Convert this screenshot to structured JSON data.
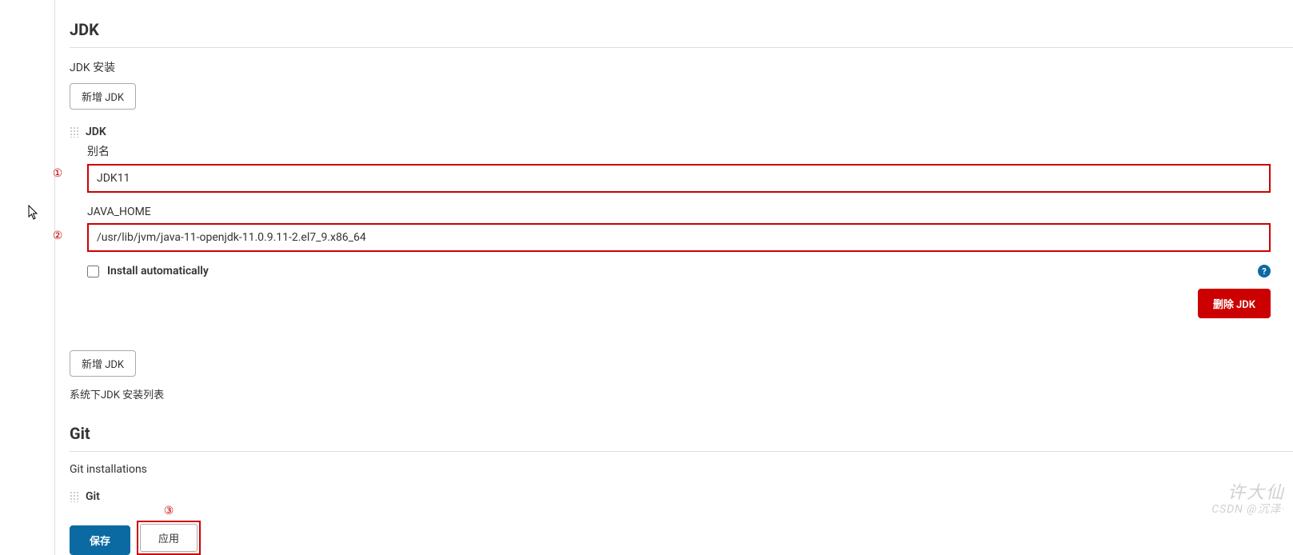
{
  "jdk": {
    "section_title": "JDK",
    "install_label": "JDK 安装",
    "add_button": "新增 JDK",
    "item_name": "JDK",
    "alias_label": "别名",
    "alias_value": "JDK11",
    "javahome_label": "JAVA_HOME",
    "javahome_value": "/usr/lib/jvm/java-11-openjdk-11.0.9.11-2.el7_9.x86_64",
    "install_auto_label": "Install automatically",
    "delete_button": "删除 JDK",
    "add_button_lower": "新增 JDK",
    "list_caption": "系统下JDK 安装列表"
  },
  "git": {
    "section_title": "Git",
    "install_label": "Git installations",
    "item_name": "Git"
  },
  "footer": {
    "save": "保存",
    "apply": "应用"
  },
  "annotations": {
    "one": "①",
    "two": "②",
    "three": "③"
  },
  "help": {
    "glyph": "?"
  },
  "watermark": {
    "main": "许大仙",
    "sub": "CSDN @沉泽·"
  }
}
